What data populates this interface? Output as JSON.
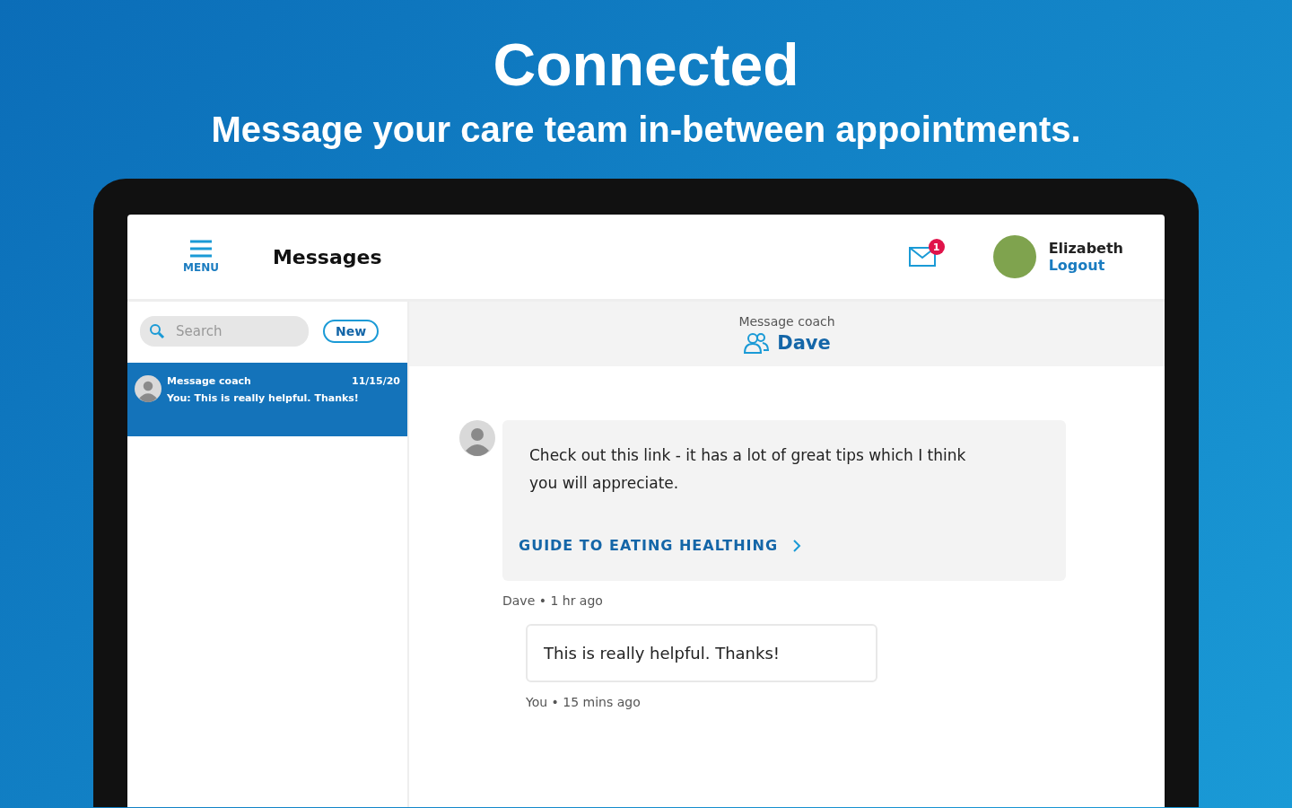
{
  "headline": "Connected",
  "subheadline": "Message your care team in-between appointments.",
  "header": {
    "menu_label": "MENU",
    "title": "Messages",
    "unread_badge": "1",
    "user_name": "Elizabeth",
    "logout": "Logout"
  },
  "sidebar": {
    "search": {
      "placeholder": "Search"
    },
    "new_button": "New",
    "conversations": [
      {
        "title": "Message coach",
        "preview": "You: This is really helpful. Thanks!",
        "date": "11/15/20",
        "selected": true
      }
    ]
  },
  "chat": {
    "subtitle": "Message coach",
    "name": "Dave",
    "messages": [
      {
        "kind": "received",
        "text": "Check out this link - it has a lot of great tips which I think you will appreciate.",
        "link": "GUIDE TO EATING HEALTHING",
        "meta": "Dave • 1 hr ago"
      },
      {
        "kind": "sent",
        "text": "This is really helpful. Thanks!",
        "meta": "You • 15 mins ago"
      }
    ]
  }
}
